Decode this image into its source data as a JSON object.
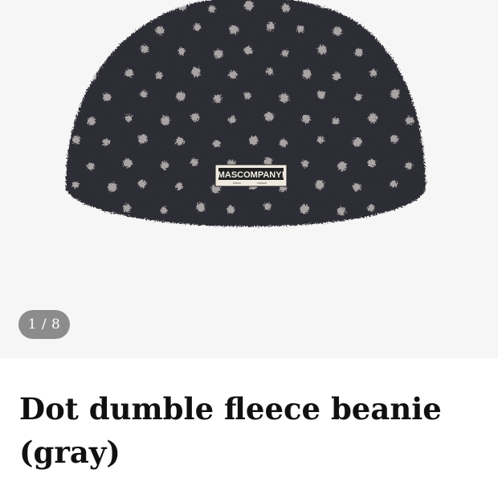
{
  "product": {
    "image_counter": "1 / 8",
    "title": "Dot dumble fleece beanie (gray)",
    "label_text": "MASCOMPANY!"
  },
  "colors": {
    "gallery_background": "#f6f6f6",
    "beanie_body": "#33323a",
    "beanie_dots": "#b9b3b3",
    "counter_background": "#8c8c8c",
    "title_text": "#111111"
  }
}
